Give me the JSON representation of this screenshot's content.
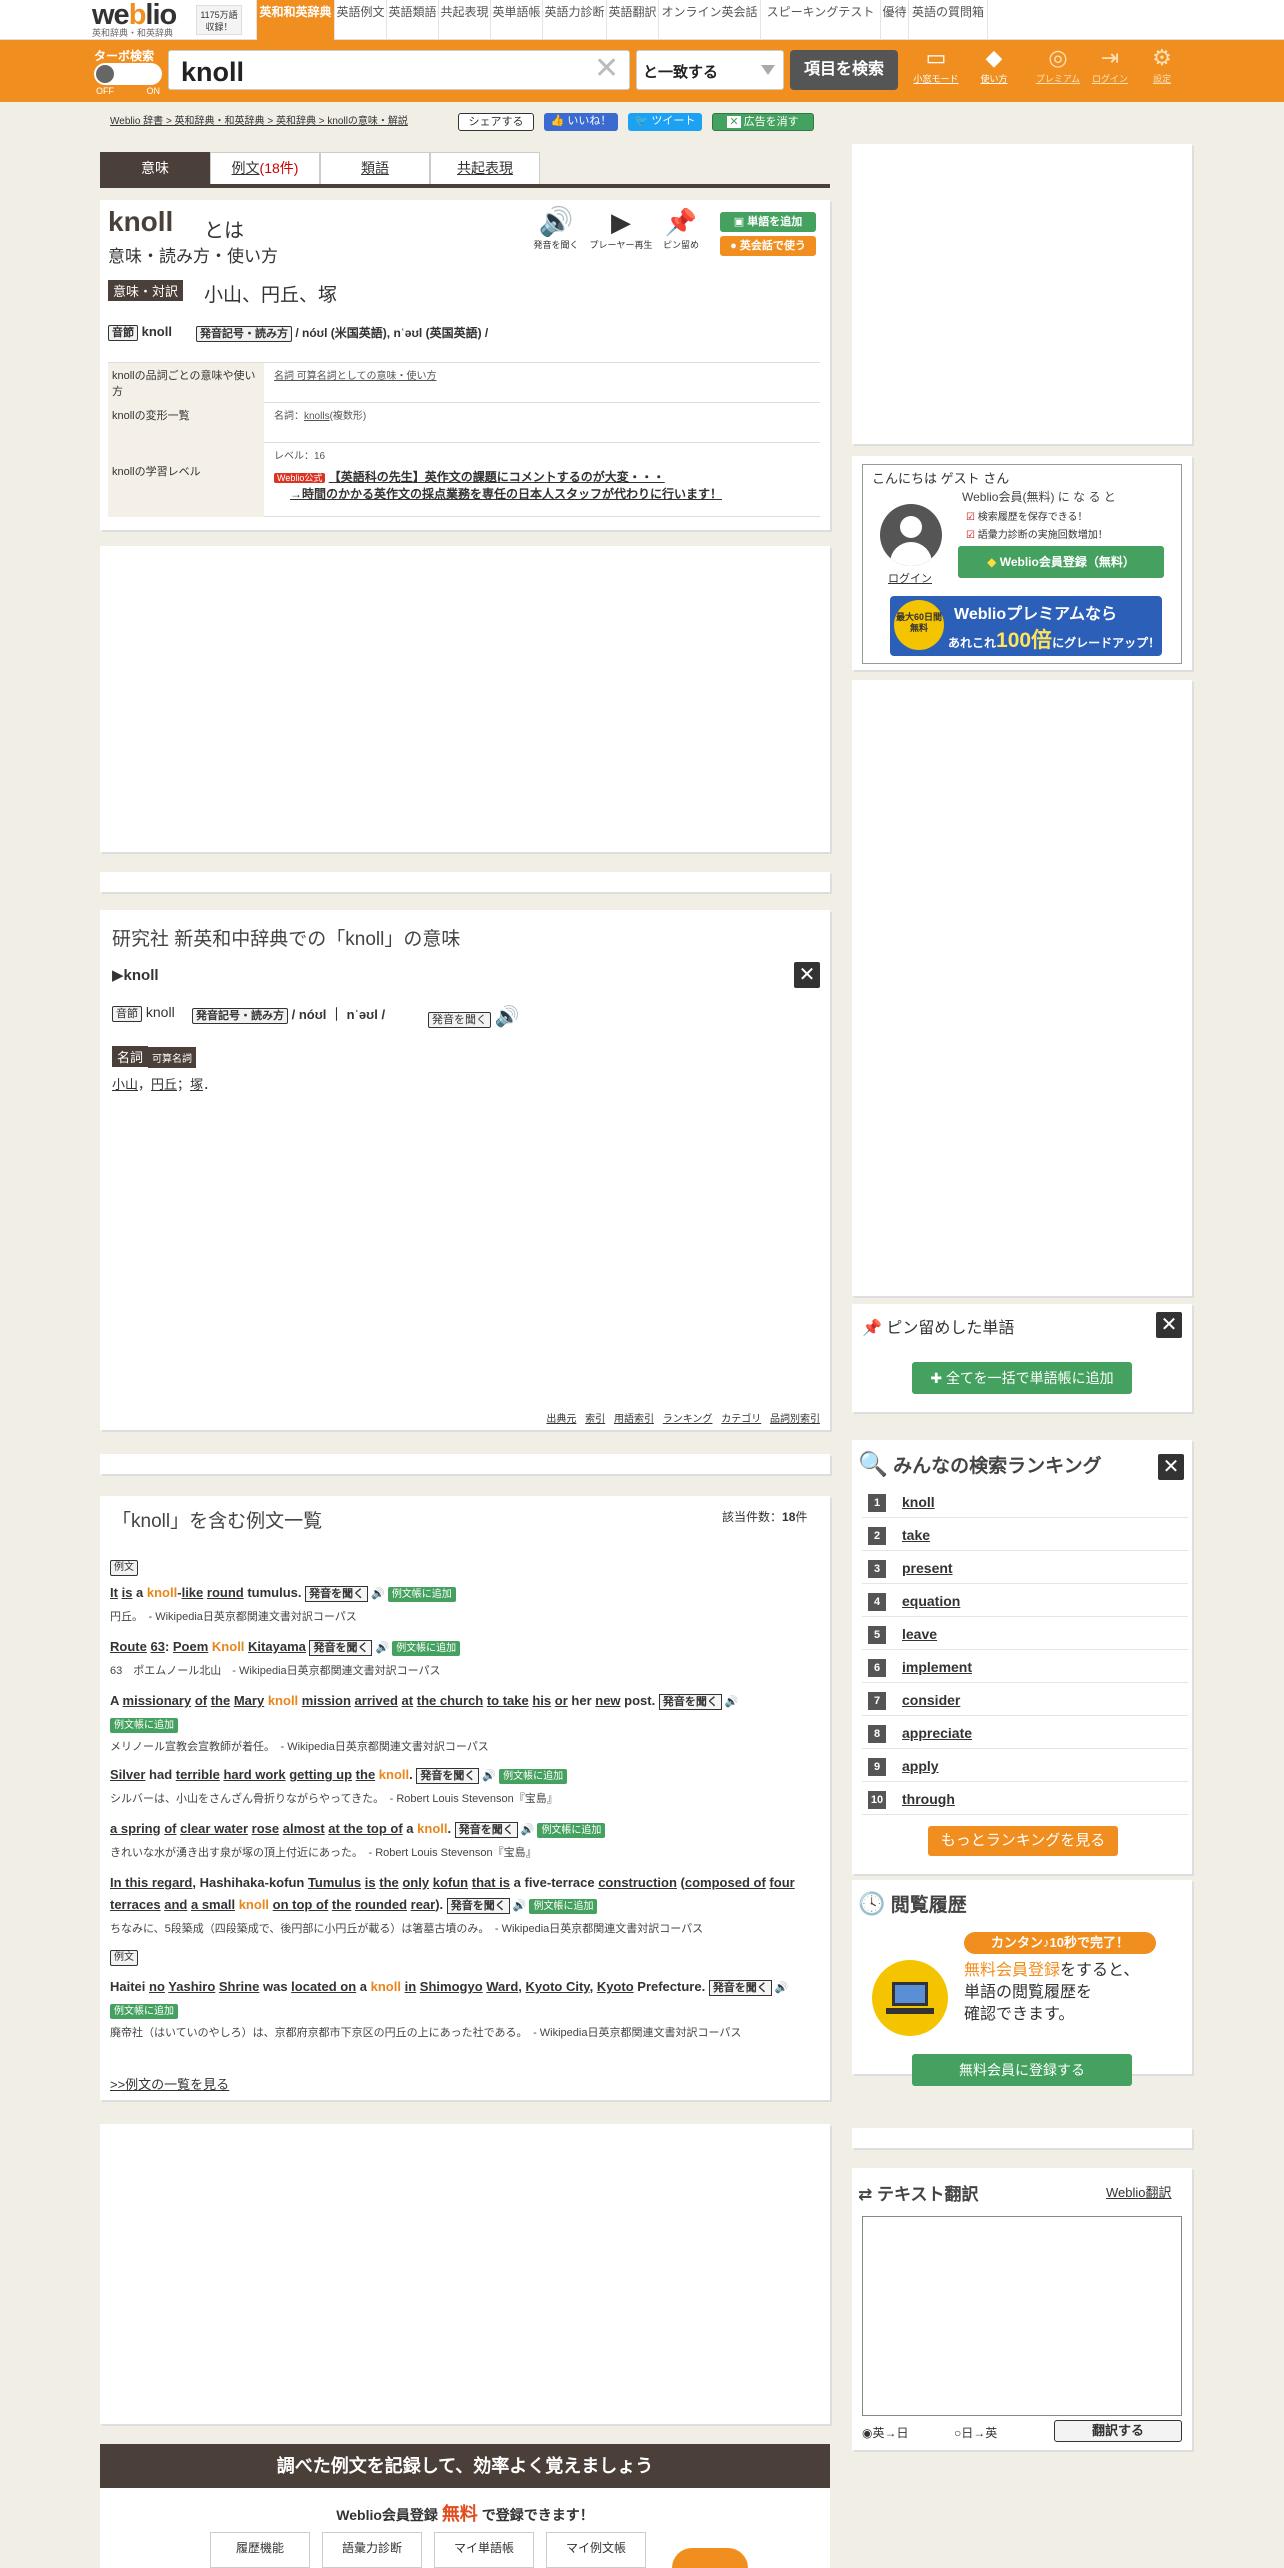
{
  "logo": {
    "text": "weblio",
    "sub": "英和辞典・和英辞典",
    "count": "1175万語収録！"
  },
  "nav": {
    "tabs": [
      "英和和英辞典",
      "英語例文",
      "英語類語",
      "共起表現",
      "英単語帳",
      "英語力診断",
      "英語翻訳",
      "オンライン英会話",
      "スピーキングテスト",
      "優待",
      "英語の質問箱"
    ]
  },
  "search": {
    "turbo": "ターボ検索",
    "off": "OFF",
    "on": "ON",
    "query": "knoll",
    "mode": "と一致する",
    "button": "項目を検索"
  },
  "tools": [
    "小窓モード",
    "使い方",
    "プレミアム",
    "ログイン",
    "設定"
  ],
  "breadcrumb": "Weblio 辞書 > 英和辞典・和英辞典 > 英和辞典 > knollの意味・解説",
  "share": {
    "share": "シェアする",
    "like": "いいね！",
    "tweet": "ツイート",
    "noad": "広告を消す"
  },
  "tabs": {
    "meaning": "意味",
    "examples": "例文",
    "examples_count": "(18件)",
    "synonyms": "類語",
    "cooccur": "共起表現"
  },
  "entry": {
    "word": "knoll",
    "towa": "とは",
    "subtitle": "意味・読み方・使い方",
    "tools": [
      "発音を聞く",
      "プレーヤー再生",
      "ピン留め"
    ],
    "add_word": "単語を追加",
    "eikaiwa": "英会話で使う",
    "meaning_label": "意味・対訳",
    "meaning": "小山、円丘、塚",
    "syllable_label": "音節",
    "syllable": "knoll",
    "pron_label": "発音記号・読み方",
    "pron": "/ nóʊl (米国英語), nˈəʊl (英国英語) /",
    "rows": [
      {
        "label": "knollの品詞ごとの意味や使い方",
        "value": "名詞 可算名詞としての意味・使い方"
      },
      {
        "label": "knollの変形一覧",
        "value": "名詞：",
        "value_link": "knolls",
        "value_suffix": "(複数形)"
      },
      {
        "label": "knollの学習レベル",
        "value": "レベル：16",
        "ad_badge": "Weblio公式",
        "ad_line1": "【英語科の先生】英作文の課題にコメントするのが大変・・・",
        "ad_line2": "→時間のかかる英作文の採点業務を専任の日本人スタッフが代わりに行います！"
      }
    ]
  },
  "kenkyusha": {
    "title": "研究社 新英和中辞典での「knoll」の意味",
    "head": "▶knoll",
    "syllable_label": "音節",
    "syllable": "knoll",
    "pron_label": "発音記号・読み方",
    "pron": "/ nóʊl ｜ nˈəʊl /",
    "listen": "発音を聞く",
    "pos": "名詞",
    "pos_sub": "可算名詞",
    "defs": [
      "小山",
      "円丘",
      "塚"
    ],
    "footer": [
      "出典元",
      "索引",
      "用語索引",
      "ランキング",
      "カテゴリ",
      "品詞別索引"
    ]
  },
  "examples": {
    "title": "「knoll」を含む例文一覧",
    "count_label": "該当件数：",
    "count": "18",
    "count_unit": "件",
    "label": "例文",
    "listen": "発音を聞く",
    "add": "例文帳に追加",
    "items": [
      {
        "en": "It is a knoll-like round tumulus.",
        "ja": "円丘。",
        "src": "- Wikipedia日英京都関連文書対訳コーパス"
      },
      {
        "en": "Route 63: Poem Knoll Kitayama",
        "ja": "63　ポエムノール北山",
        "src": "- Wikipedia日英京都関連文書対訳コーパス"
      },
      {
        "en": "A missionary of the Mary knoll mission arrived at the church to take his or her new post.",
        "ja": "メリノール宣教会宣教師が着任。",
        "src": "- Wikipedia日英京都関連文書対訳コーパス"
      },
      {
        "en": "Silver had terrible hard work getting up the knoll.",
        "ja": "シルバーは、小山をさんざん骨折りながらやってきた。",
        "src": "- Robert Louis Stevenson『宝島』"
      },
      {
        "en": "a spring of clear water rose almost at the top of a knoll.",
        "ja": "きれいな水が湧き出す泉が塚の頂上付近にあった。",
        "src": "- Robert Louis Stevenson『宝島』"
      },
      {
        "en": "In this regard, Hashihaka-kofun Tumulus is the only kofun that is a five-terrace construction (composed of four terraces and a small knoll on top of the rounded rear).",
        "ja": "ちなみに、5段築成（四段築成で、後円部に小円丘が載る）は箸墓古墳のみ。",
        "src": "- Wikipedia日英京都関連文書対訳コーパス"
      },
      {
        "en": "Haitei no Yashiro Shrine was located on a knoll in Shimogyo Ward, Kyoto City, Kyoto Prefecture.",
        "ja": "廃帝社（はいていのやしろ）は、京都府京都市下京区の円丘の上にあった社である。",
        "src": "- Wikipedia日英京都関連文書対訳コーパス"
      }
    ],
    "more": ">>例文の一覧を見る"
  },
  "banner": {
    "title": "調べた例文を記録して、効率よく覚えましょう",
    "sub_pre": "Weblio会員登録",
    "sub_free": "無料",
    "sub_post": "で登録できます！",
    "features": [
      "履歴機能",
      "語彙力診断",
      "マイ単語帳",
      "マイ例文帳"
    ]
  },
  "guest": {
    "hello": "こんにちは ゲスト さん",
    "member": "Weblio会員(無料) に な る と",
    "benefits": [
      "検索履歴を保存できる！",
      "語彙力診断の実施回数増加！"
    ],
    "login": "ログイン",
    "register": "Weblio会員登録（無料）",
    "premium_badge": "最大60日間無料",
    "premium_line1": "Weblioプレミアムなら",
    "premium_pre": "あれこれ",
    "premium_big": "100倍",
    "premium_post": "にグレードアップ！"
  },
  "pinned": {
    "title": "ピン留めした単語",
    "add_all": "全てを一括で単語帳に追加"
  },
  "ranking": {
    "title": "みんなの検索ランキング",
    "items": [
      "knoll",
      "take",
      "present",
      "equation",
      "leave",
      "implement",
      "consider",
      "appreciate",
      "apply",
      "through"
    ],
    "more": "もっとランキングを見る"
  },
  "history": {
    "title": "閲覧履歴",
    "badge": "カンタン♪10秒で完了！",
    "line1_em": "無料会員登録",
    "line1": "をすると、",
    "line2": "単語の閲覧履歴を",
    "line3": "確認できます。",
    "button": "無料会員に登録する"
  },
  "translate": {
    "title": "テキスト翻訳",
    "link": "Weblio翻訳",
    "opt1": "英→日",
    "opt2": "日→英",
    "button": "翻訳する"
  },
  "colors": {
    "orange": "#f08f1f",
    "dark": "#4b4039",
    "green": "#45a15f"
  }
}
